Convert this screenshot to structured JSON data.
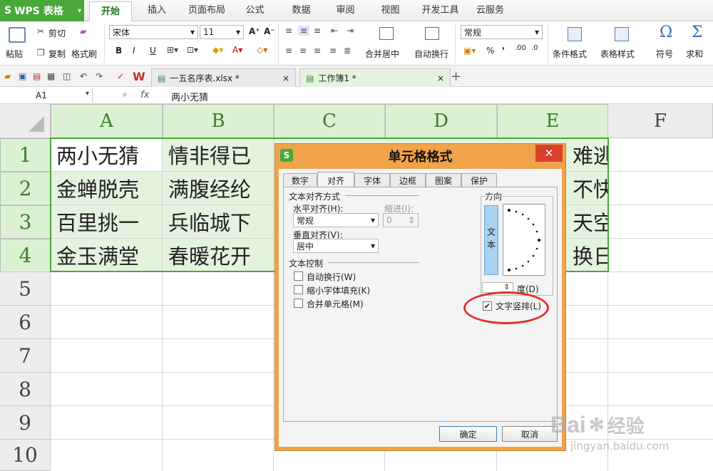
{
  "app": {
    "name": "WPS 表格",
    "caret": "▾"
  },
  "menu_tabs": [
    "开始",
    "插入",
    "页面布局",
    "公式",
    "数据",
    "审阅",
    "视图",
    "开发工具",
    "云服务"
  ],
  "ribbon": {
    "paste": "粘贴",
    "cut": "剪切",
    "copy": "复制",
    "format_painter": "格式刷",
    "font_name": "宋体",
    "font_size": "11",
    "grow": "A⁺",
    "shrink": "A⁻",
    "bold": "B",
    "italic": "I",
    "underline": "U",
    "merge_center": "合并居中",
    "wrap_text": "自动换行",
    "number_format": "常规",
    "percent": "%",
    "comma": "❜",
    "dec_up": ".00",
    "dec_down": ".0",
    "conditional_format": "条件格式",
    "table_style": "表格样式",
    "symbol": "符号",
    "sum": "求和",
    "symbol_glyph": "Ω",
    "sum_glyph": "Σ"
  },
  "doc_tabs": [
    {
      "name": "一五名序表.xlsx *",
      "close": "×"
    },
    {
      "name": "工作簿1 *",
      "close": "×"
    }
  ],
  "new_tab": "+",
  "formula": {
    "cell_ref": "A1",
    "fx": "fx",
    "value": "两小无猜",
    "caret": "▾"
  },
  "columns": [
    "A",
    "B",
    "C",
    "D",
    "E",
    "F"
  ],
  "rows": [
    "1",
    "2",
    "3",
    "4",
    "5",
    "6",
    "7",
    "8",
    "9",
    "10"
  ],
  "cells_a": [
    "两小无猜",
    "金蝉脱壳",
    "百里挑一",
    "金玉满堂"
  ],
  "cells_b": [
    "情非得已",
    "满腹经纶",
    "兵临城下",
    "春暖花开"
  ],
  "cells_e": [
    "难逃",
    "不快",
    "天空",
    "换日"
  ],
  "dialog": {
    "title": "单元格格式",
    "close": "✕",
    "tabs": [
      "数字",
      "对齐",
      "字体",
      "边框",
      "图案",
      "保护"
    ],
    "text_align_section": "文本对齐方式",
    "horiz_label": "水平对齐(H):",
    "horiz_value": "常规",
    "indent_label": "缩进(I):",
    "indent_value": "0",
    "vert_label": "垂直对齐(V):",
    "vert_value": "居中",
    "text_control_section": "文本控制",
    "wrap": "自动换行(W)",
    "shrink": "缩小字体填充(K)",
    "merge": "合并单元格(M)",
    "orientation_section": "方向",
    "vertical_text_sample": "文本",
    "degree_label": "度(D)",
    "vertical_text": "文字竖排(L)",
    "vertical_text_checked": "✔",
    "ok": "确定",
    "cancel": "取消"
  },
  "watermark": {
    "brand": "Bai",
    "cn": "经验",
    "url": "jingyan.baidu.com"
  },
  "colors": {
    "accent_green": "#4aa73a",
    "dialog_orange": "#f0a34a",
    "highlight_red": "#e0322a"
  }
}
